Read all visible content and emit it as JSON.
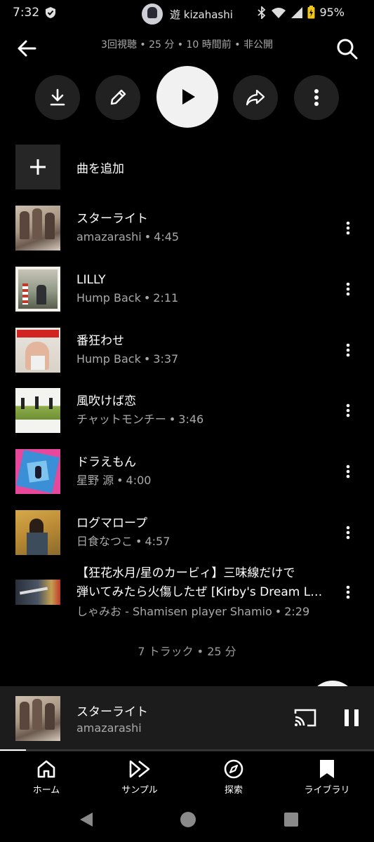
{
  "status_bar": {
    "time": "7:32",
    "username": "遊 kizahashi",
    "battery": "95%"
  },
  "header": {
    "meta": "3回視聴 • 25 分 • 10 時間前 • 非公開"
  },
  "add_song": {
    "label": "曲を追加"
  },
  "tracks": [
    {
      "title": "スターライト",
      "artist": "amazarashi",
      "duration": "4:45"
    },
    {
      "title": "LILLY",
      "artist": "Hump Back",
      "duration": "2:11"
    },
    {
      "title": "番狂わせ",
      "artist": "Hump Back",
      "duration": "3:37"
    },
    {
      "title": "風吹けば恋",
      "artist": "チャットモンチー",
      "duration": "3:46"
    },
    {
      "title": "ドラえもん",
      "artist": "星野 源",
      "duration": "4:00"
    },
    {
      "title": "ログマロープ",
      "artist": "日食なつこ",
      "duration": "4:57"
    },
    {
      "title_line1": "【狂花水月/星のカービィ】三味線だけで",
      "title_line2": "弾いてみたら火傷したぜ [Kirby's Dream Land]",
      "artist": "しゃみお - Shamisen player Shamio",
      "duration": "2:29"
    }
  ],
  "summary": "7 トラック • 25 分",
  "mini_player": {
    "title": "スターライト",
    "artist": "amazarashi",
    "progress": 0.07
  },
  "bottom_nav": [
    {
      "label": "ホーム",
      "icon": "home-icon"
    },
    {
      "label": "サンプル",
      "icon": "samples-icon"
    },
    {
      "label": "探索",
      "icon": "explore-icon"
    },
    {
      "label": "ライブラリ",
      "icon": "library-icon"
    }
  ]
}
